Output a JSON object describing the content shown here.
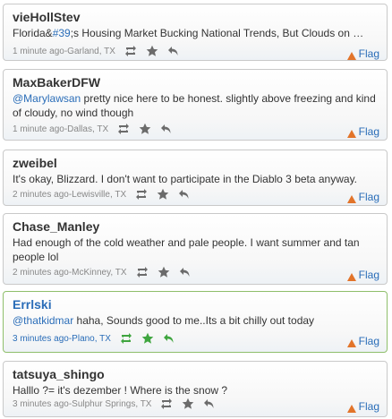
{
  "tweets": [
    {
      "user": "vieHollStev",
      "text": "Florida&",
      "hash": "#39",
      "text2": ";s Housing Market Bucking National Trends, But Clouds on …",
      "mention": "",
      "time": "1 minute ago",
      "location": "Garland, TX"
    },
    {
      "user": "MaxBakerDFW",
      "mention": "@Marylawsan",
      "text": " pretty nice here to be honest. slightly above freezing and kind of cloudy, no wind though",
      "time": "1 minute ago",
      "location": "Dallas, TX"
    },
    {
      "user": "zweibel",
      "mention": "",
      "text": "It's okay, Blizzard. I don't want to participate in the Diablo 3 beta anyway.",
      "time": "2 minutes ago",
      "location": "Lewisville, TX"
    },
    {
      "user": "Chase_Manley",
      "mention": "",
      "text": "Had enough of the cold weather and pale people. I want summer and tan people lol",
      "time": "2 minutes ago",
      "location": "McKinney, TX"
    },
    {
      "user": "Errlski",
      "mention": "@thatkidmar",
      "text": " haha, Sounds good to me..Its a bit chilly out today",
      "time": "3 minutes ago",
      "location": "Plano, TX"
    },
    {
      "user": "tatsuya_shingo",
      "mention": "",
      "text": "Halllo ?= it's dezember ! Where is the snow ?",
      "time": "3 minutes ago",
      "location": "Sulphur Springs, TX"
    }
  ],
  "meta_separator": "- ",
  "flag_label": "Flag",
  "colors": {
    "link": "#2a6db8",
    "flag": "#e2742a",
    "highlight_border": "#8fbf6b",
    "highlight_icon": "#3fa53f"
  }
}
